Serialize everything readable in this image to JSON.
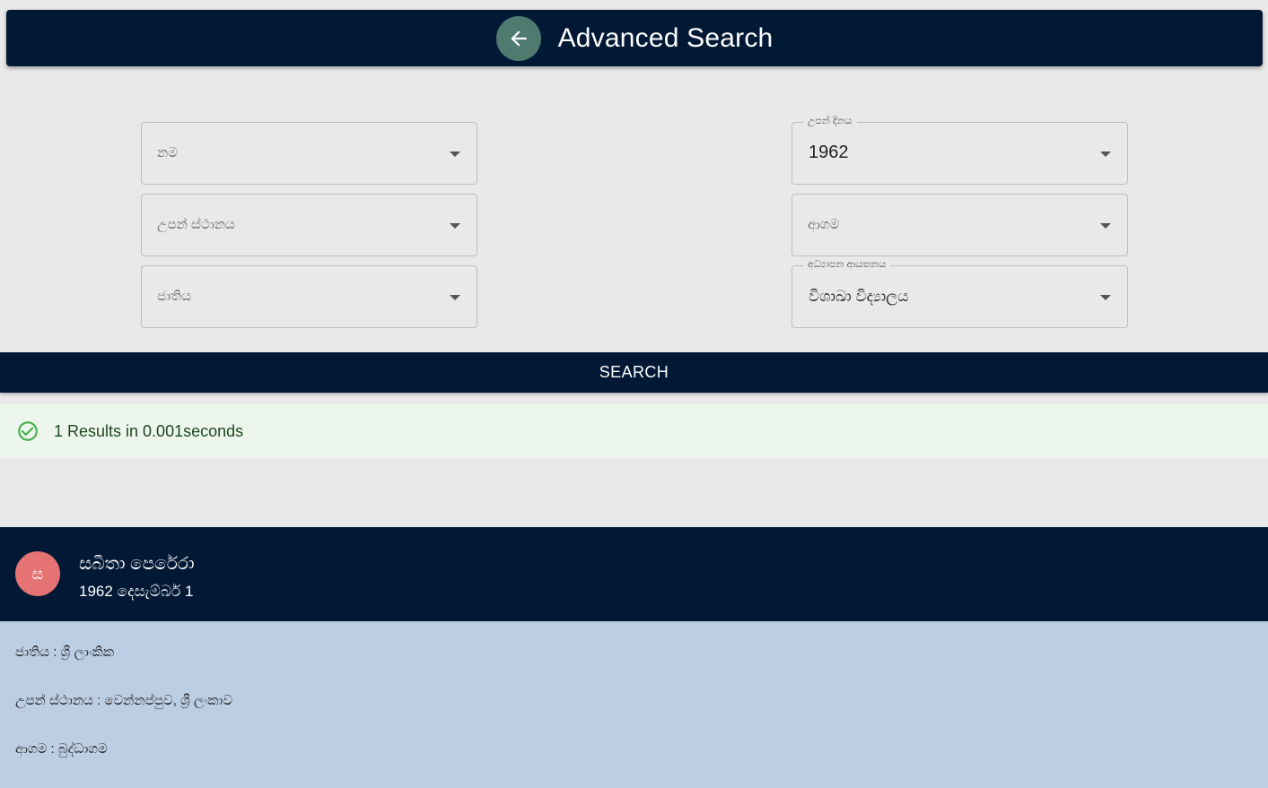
{
  "appbar": {
    "title": "Advanced Search",
    "back_icon": "arrow-left-icon"
  },
  "filters": {
    "name": {
      "placeholder": "නම"
    },
    "birthplace": {
      "placeholder": "උපන් ස්ථානය"
    },
    "nationality": {
      "placeholder": "ජාතිය"
    },
    "birthdate": {
      "label": "උපන් දිනය",
      "value": "1962"
    },
    "religion": {
      "placeholder": "ආගම"
    },
    "school": {
      "label": "අධ්‍යාපන ආයතනය",
      "value": "විශාඛා විද්‍යාලය"
    }
  },
  "search_button": {
    "label": "SEARCH"
  },
  "alert": {
    "text": "1 Results in 0.001seconds",
    "icon": "check-circle-icon",
    "color": "#4caf50"
  },
  "result": {
    "avatar_letter": "ස",
    "avatar_color": "#e57373",
    "name": "සබීතා පෙරේරා",
    "date": "1962 දෙසැම්බර් 1",
    "details": [
      {
        "text": "ජාතිය : ශ්‍රී ලාංකික"
      },
      {
        "text": "උපන් ස්ථානය : වෙන්නප්පුව, ශ්‍රී ලංකාව"
      },
      {
        "text": "ආගම : බුද්ධාගම"
      }
    ]
  },
  "colors": {
    "primary": "#021936",
    "background": "#e9e9e9",
    "back_button": "#4f7a70",
    "result_body": "#bccee4"
  }
}
